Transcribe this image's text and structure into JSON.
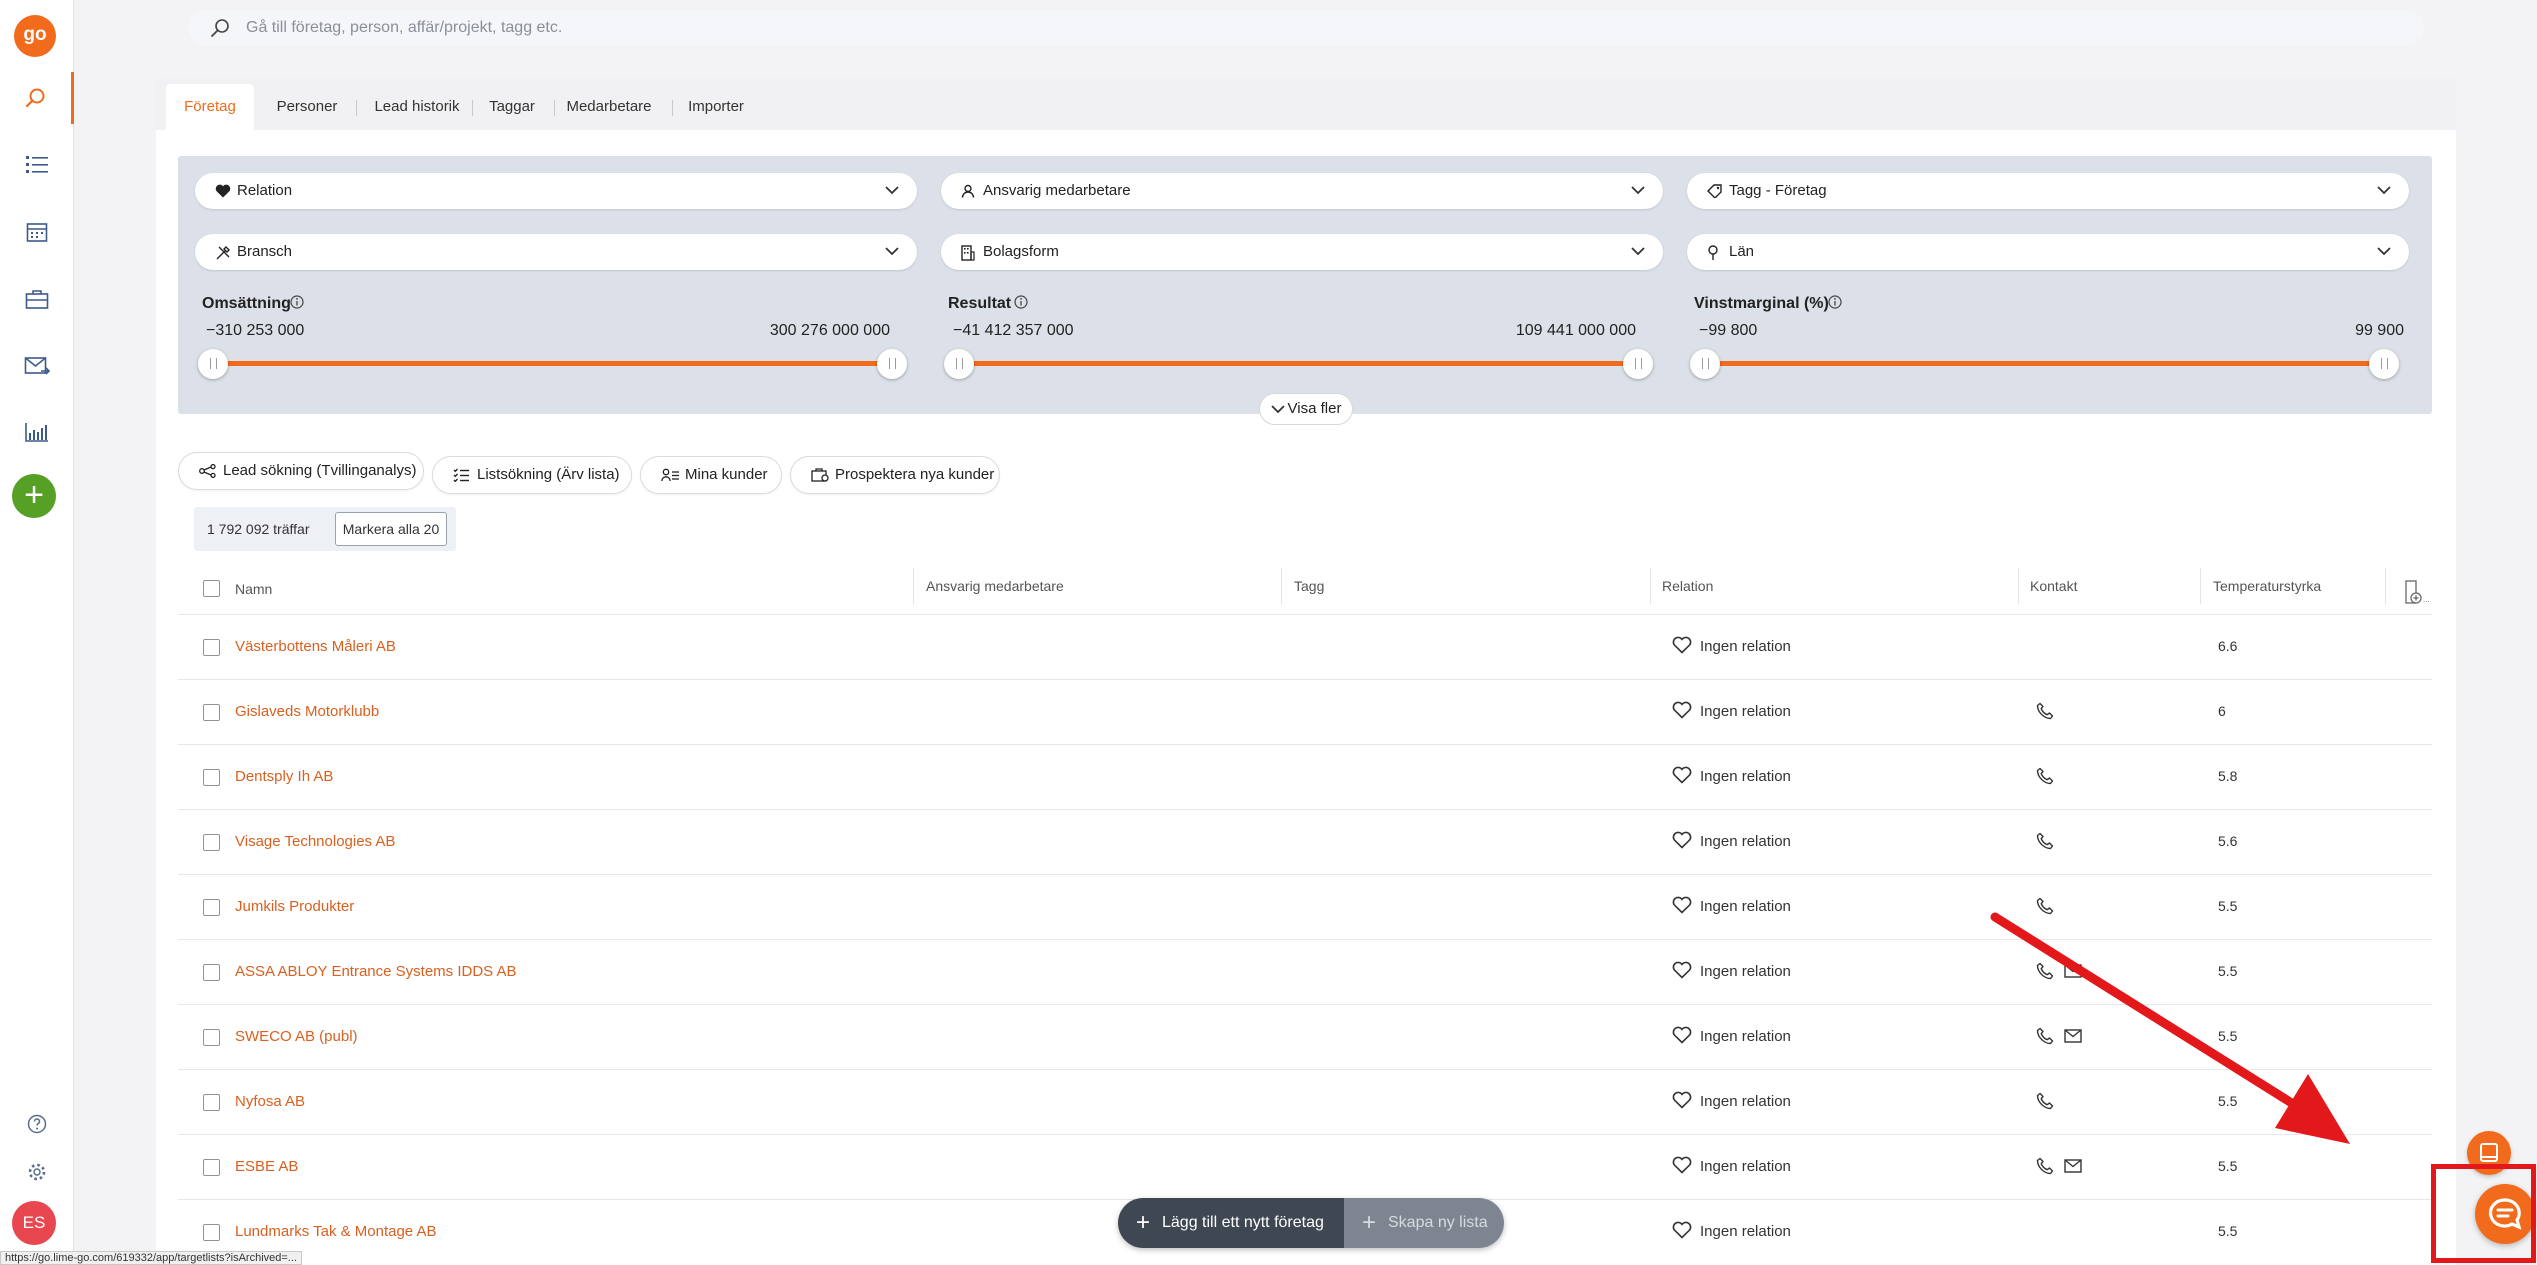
{
  "app": {
    "logo_text": "go",
    "brand_color": "#f26a1b",
    "avatar_initials": "ES"
  },
  "sidebar": {
    "items": [
      {
        "name": "search",
        "icon": "search-icon",
        "active": true
      },
      {
        "name": "lists",
        "icon": "list-icon"
      },
      {
        "name": "calendar",
        "icon": "calendar-icon"
      },
      {
        "name": "deals",
        "icon": "briefcase-icon"
      },
      {
        "name": "mail",
        "icon": "mail-icon"
      },
      {
        "name": "reports",
        "icon": "chart-icon"
      }
    ],
    "add_icon": "plus-icon",
    "help_icon": "help-icon",
    "settings_icon": "gear-icon"
  },
  "search": {
    "placeholder": "Gå till företag, person, affär/projekt, tagg etc."
  },
  "tabs": [
    "Företag",
    "Personer",
    "Lead historik",
    "Taggar",
    "Medarbetare",
    "Importer"
  ],
  "filters": {
    "dropdowns": [
      {
        "label": "Relation",
        "icon": "heart-icon"
      },
      {
        "label": "Ansvarig medarbetare",
        "icon": "person-icon"
      },
      {
        "label": "Tagg - Företag",
        "icon": "tag-icon"
      },
      {
        "label": "Bransch",
        "icon": "tools-icon"
      },
      {
        "label": "Bolagsform",
        "icon": "building-icon"
      },
      {
        "label": "Län",
        "icon": "pin-icon"
      }
    ],
    "ranges": [
      {
        "label": "Omsättning",
        "min": "−310 253 000",
        "max": "300 276 000 000"
      },
      {
        "label": "Resultat",
        "min": "−41 412 357 000",
        "max": "109 441 000 000"
      },
      {
        "label": "Vinstmarginal (%)",
        "min": "−99 800",
        "max": "99 900"
      }
    ],
    "show_more": "Visa fler"
  },
  "search_modes": [
    {
      "label": "Lead sökning (Tvillinganalys)",
      "icon": "share-icon"
    },
    {
      "label": "Listsökning (Ärv lista)",
      "icon": "checklist-icon"
    },
    {
      "label": "Mina kunder",
      "icon": "people-list-icon"
    },
    {
      "label": "Prospektera nya kunder",
      "icon": "prospect-icon"
    }
  ],
  "results": {
    "count_text": "1 792 092 träffar",
    "mark_all": "Markera alla 20"
  },
  "table": {
    "columns": [
      "Namn",
      "Ansvarig medarbetare",
      "Tagg",
      "Relation",
      "Kontakt",
      "Temperaturstyrka"
    ],
    "rows": [
      {
        "name": "Västerbottens Måleri AB",
        "relation": "Ingen relation",
        "phone": false,
        "mail": false,
        "temp": "6.6"
      },
      {
        "name": "Gislaveds Motorklubb",
        "relation": "Ingen relation",
        "phone": true,
        "mail": false,
        "temp": "6"
      },
      {
        "name": "Dentsply Ih AB",
        "relation": "Ingen relation",
        "phone": true,
        "mail": false,
        "temp": "5.8"
      },
      {
        "name": "Visage Technologies AB",
        "relation": "Ingen relation",
        "phone": true,
        "mail": false,
        "temp": "5.6"
      },
      {
        "name": "Jumkils Produkter",
        "relation": "Ingen relation",
        "phone": true,
        "mail": false,
        "temp": "5.5"
      },
      {
        "name": "ASSA ABLOY Entrance Systems IDDS AB",
        "relation": "Ingen relation",
        "phone": true,
        "mail": true,
        "temp": "5.5"
      },
      {
        "name": "SWECO AB (publ)",
        "relation": "Ingen relation",
        "phone": true,
        "mail": true,
        "temp": "5.5"
      },
      {
        "name": "Nyfosa AB",
        "relation": "Ingen relation",
        "phone": true,
        "mail": false,
        "temp": "5.5"
      },
      {
        "name": "ESBE AB",
        "relation": "Ingen relation",
        "phone": true,
        "mail": true,
        "temp": "5.5"
      },
      {
        "name": "Lundmarks Tak & Montage AB",
        "relation": "Ingen relation",
        "phone": false,
        "mail": false,
        "temp": "5.5"
      }
    ]
  },
  "bottom_bar": {
    "add_company": "Lägg till ett nytt företag",
    "create_list": "Skapa ny lista"
  },
  "status_bar": {
    "url": "https://go.lime-go.com/619332/app/targetlists?isArchived=..."
  },
  "annotation": {
    "color": "#e2181b"
  }
}
